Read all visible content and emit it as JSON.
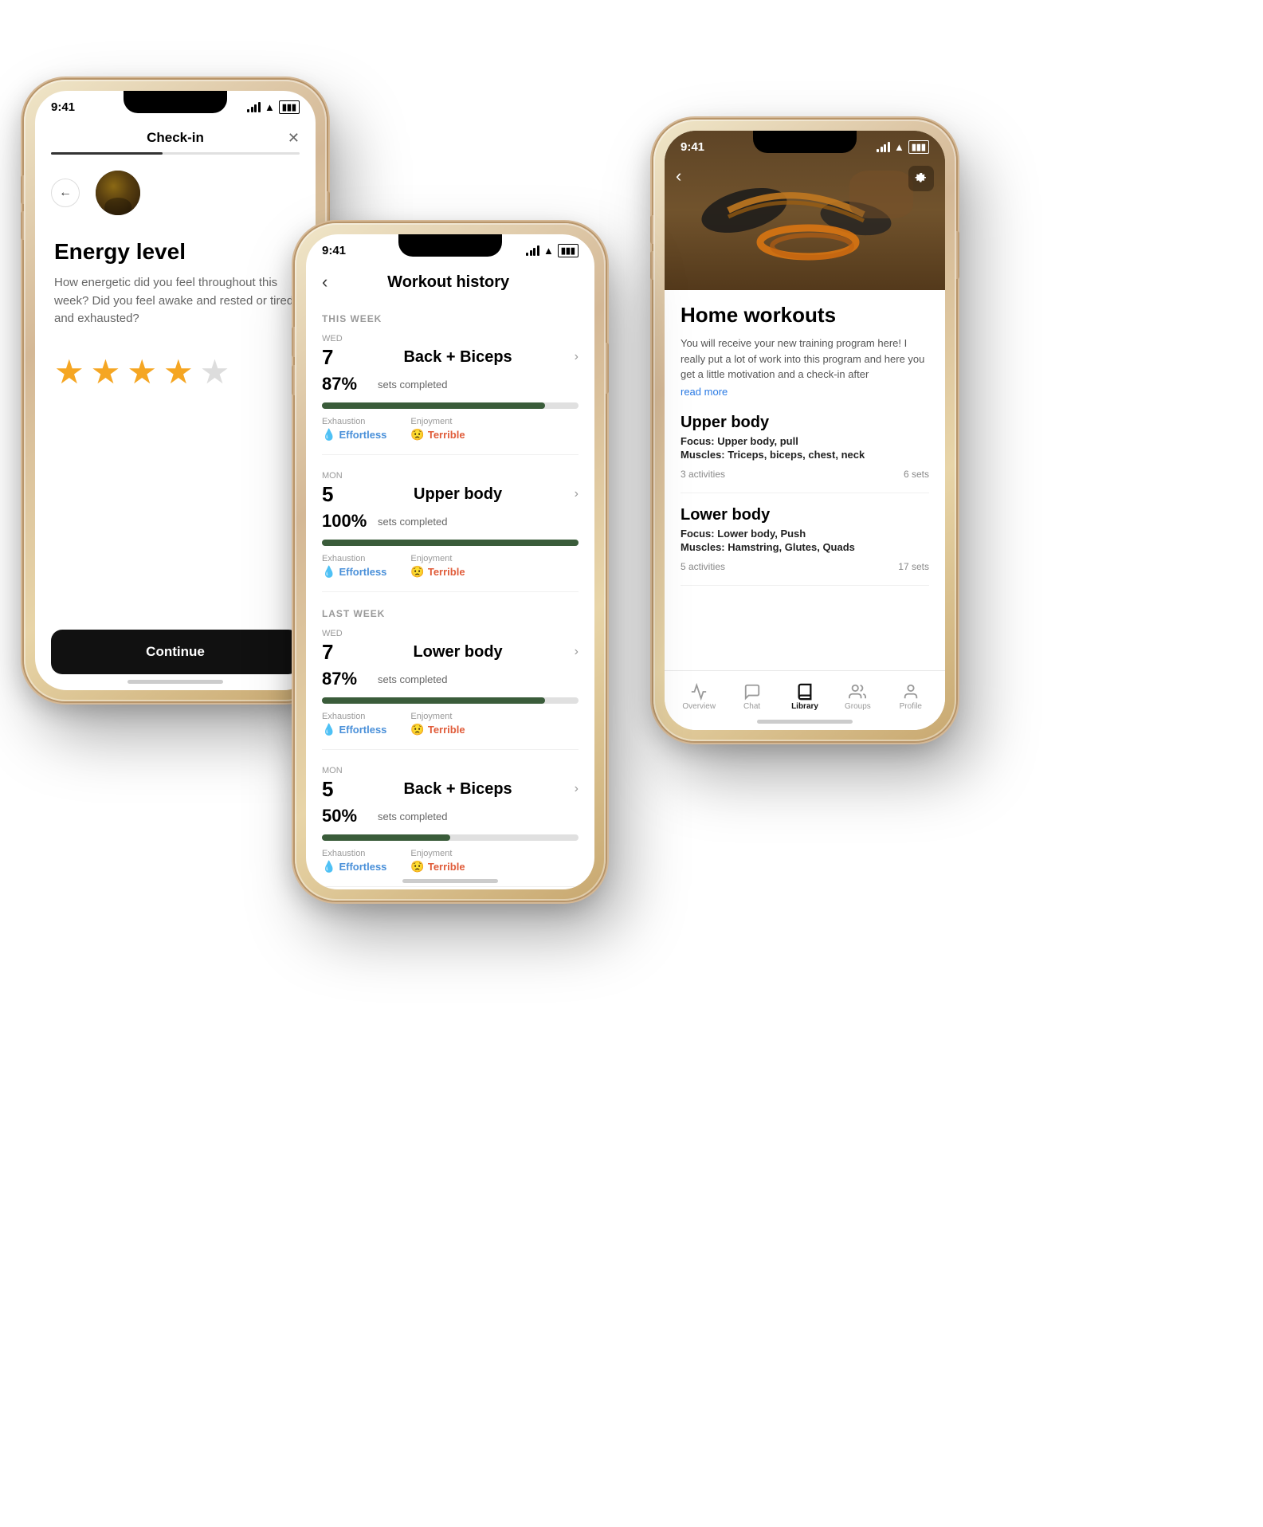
{
  "phone1": {
    "status": {
      "time": "9:41",
      "signal": true,
      "wifi": true,
      "battery": true
    },
    "header": {
      "title": "Check-in",
      "close_symbol": "✕"
    },
    "back_btn": "←",
    "section_title": "Energy level",
    "section_desc": "How energetic did you feel throughout this week? Did you feel awake and rested or tired and exhausted?",
    "stars": [
      {
        "filled": true
      },
      {
        "filled": true
      },
      {
        "filled": true
      },
      {
        "filled": true
      },
      {
        "filled": false
      }
    ],
    "continue_btn": "Continue"
  },
  "phone2": {
    "status": {
      "time": "9:41"
    },
    "back_btn": "‹",
    "header": {
      "title": "Workout history"
    },
    "this_week_label": "THIS WEEK",
    "last_week_label": "LAST WEEK",
    "workouts": [
      {
        "week": "this",
        "day": "WED",
        "date": "7",
        "name": "Back + Biceps",
        "pct": "87%",
        "pct_num": 87,
        "progress_label": "sets completed",
        "exhaustion_emoji": "💧",
        "exhaustion": "Effortless",
        "enjoyment_emoji": "😟",
        "enjoyment": "Terrible"
      },
      {
        "week": "this",
        "day": "MON",
        "date": "5",
        "name": "Upper body",
        "pct": "100%",
        "pct_num": 100,
        "progress_label": "sets completed",
        "exhaustion_emoji": "💧",
        "exhaustion": "Effortless",
        "enjoyment_emoji": "😟",
        "enjoyment": "Terrible"
      },
      {
        "week": "last",
        "day": "WED",
        "date": "7",
        "name": "Lower body",
        "pct": "87%",
        "pct_num": 87,
        "progress_label": "sets completed",
        "exhaustion_emoji": "💧",
        "exhaustion": "Effortless",
        "enjoyment_emoji": "😟",
        "enjoyment": "Terrible"
      },
      {
        "week": "last",
        "day": "MON",
        "date": "5",
        "name": "Back + Biceps",
        "pct": "50%",
        "pct_num": 50,
        "progress_label": "sets completed",
        "exhaustion_emoji": "💧",
        "exhaustion": "Effortless",
        "enjoyment_emoji": "😟",
        "enjoyment": "Terrible"
      }
    ],
    "exhaustion_label": "Exhaustion",
    "enjoyment_label": "Enjoyment"
  },
  "phone3": {
    "status": {
      "time": "9:41"
    },
    "hero_back": "‹",
    "hero_icon": "↕",
    "title": "Home workouts",
    "description": "You will receive your new training program here! I really put a lot of work into this program and here you get a little motivation and a check-in after",
    "read_more": "read more",
    "sections": [
      {
        "title": "Upper body",
        "focus_label": "Focus:",
        "focus_value": "Upper body, pull",
        "muscles_label": "Muscles:",
        "muscles_value": "Triceps, biceps, chest, neck",
        "activities": "3 activities",
        "sets": "6 sets"
      },
      {
        "title": "Lower body",
        "focus_label": "Focus:",
        "focus_value": "Lower body, Push",
        "muscles_label": "Muscles:",
        "muscles_value": "Hamstring, Glutes, Quads",
        "activities": "5 activities",
        "sets": "17 sets"
      }
    ],
    "nav": {
      "items": [
        {
          "label": "Overview",
          "icon": "overview",
          "active": false
        },
        {
          "label": "Chat",
          "icon": "chat",
          "active": false
        },
        {
          "label": "Library",
          "icon": "library",
          "active": true
        },
        {
          "label": "Groups",
          "icon": "groups",
          "active": false
        },
        {
          "label": "Profile",
          "icon": "profile",
          "active": false
        }
      ]
    }
  }
}
